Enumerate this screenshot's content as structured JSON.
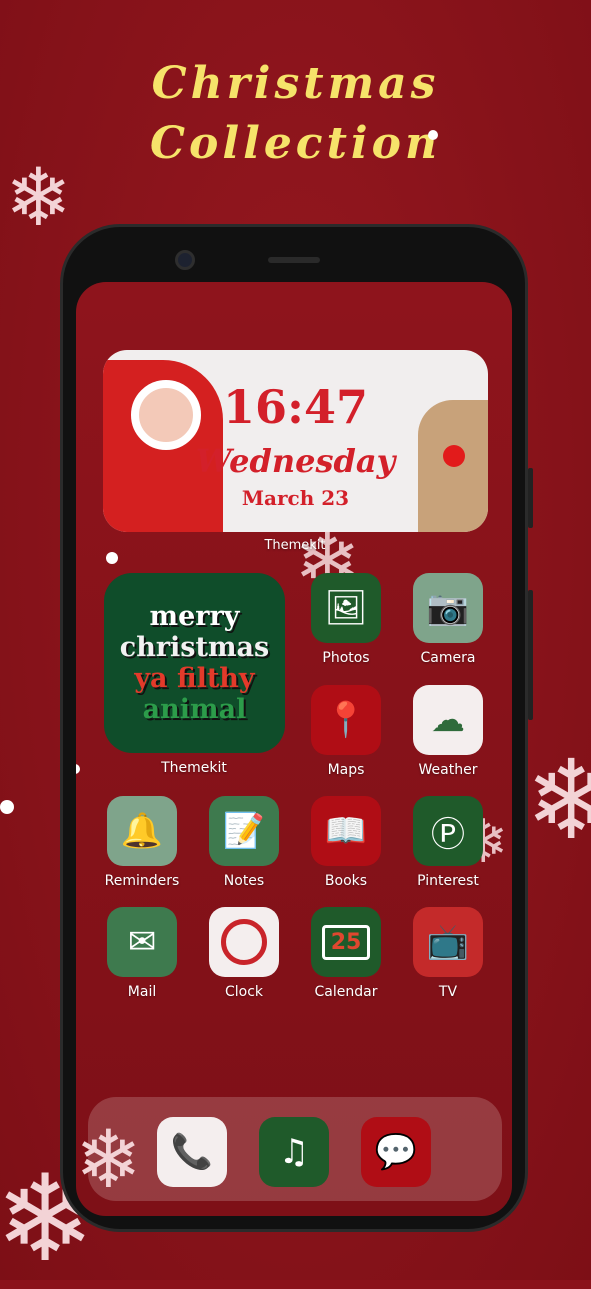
{
  "header": {
    "line1": "Christmas",
    "line2": "Collection"
  },
  "widget": {
    "time": "16:47",
    "day": "Wednesday",
    "date": "March 23",
    "label": "Themekit"
  },
  "big_widget": {
    "lines": [
      "merry",
      "christmas",
      "ya filthy",
      "animal"
    ],
    "label": "Themekit"
  },
  "apps": [
    {
      "label": "Photos",
      "icon": "photos-icon",
      "bg": "#1f5a2a"
    },
    {
      "label": "Camera",
      "icon": "camera-icon",
      "bg": "#7fa48b"
    },
    {
      "label": "Maps",
      "icon": "map-pin-icon",
      "bg": "#b00d15"
    },
    {
      "label": "Weather",
      "icon": "cloud-moon-icon",
      "bg": "#f4eeee"
    },
    {
      "label": "Reminders",
      "icon": "bells-icon",
      "bg": "#7fa48b"
    },
    {
      "label": "Notes",
      "icon": "notes-icon",
      "bg": "#3e7a4e"
    },
    {
      "label": "Books",
      "icon": "book-icon",
      "bg": "#b00d15"
    },
    {
      "label": "Pinterest",
      "icon": "pinterest-icon",
      "bg": "#1f5a2a"
    },
    {
      "label": "Mail",
      "icon": "mail-icon",
      "bg": "#3e7a4e"
    },
    {
      "label": "Clock",
      "icon": "clock-icon",
      "bg": "#f4eeee"
    },
    {
      "label": "Calendar",
      "icon": "calendar-icon",
      "bg": "#1f5a2a"
    },
    {
      "label": "TV",
      "icon": "tv-icon",
      "bg": "#c42a2a"
    }
  ],
  "calendar_number": "25",
  "dock": [
    {
      "icon": "phone-icon",
      "bg": "#f4eeee"
    },
    {
      "icon": "music-icon",
      "bg": "#1f5a2a"
    },
    {
      "icon": "messages-icon",
      "bg": "#b00d15"
    }
  ]
}
